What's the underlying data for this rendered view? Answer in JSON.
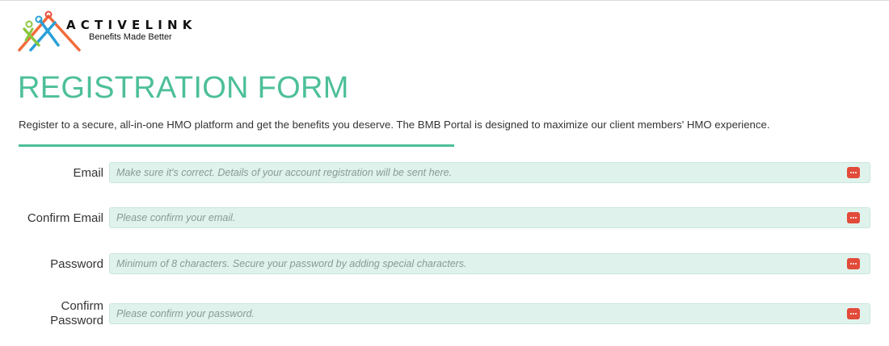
{
  "brand": {
    "name": "ACTIVELINK",
    "tagline": "Benefits Made Better",
    "colors": {
      "orange": "#f26b3a",
      "blue": "#2a9fd8",
      "green": "#8cc63f",
      "red": "#e94e3c"
    }
  },
  "header": {
    "title": "REGISTRATION FORM",
    "intro": "Register to a secure, all-in-one HMO platform and get the benefits you deserve. The BMB Portal is designed to maximize our client members' HMO experience."
  },
  "theme": {
    "accent": "#4dbf9a",
    "field_bg": "#dff3ec",
    "icon_red": "#e24b3a"
  },
  "form": {
    "fields": [
      {
        "label": "Email",
        "placeholder": "Make sure it's correct. Details of your account registration will be sent here.",
        "value": "",
        "icon": "password-manager-icon"
      },
      {
        "label": "Confirm Email",
        "placeholder": "Please confirm your email.",
        "value": "",
        "icon": "password-manager-icon"
      },
      {
        "label": "Password",
        "placeholder": "Minimum of 8 characters. Secure your password by adding special characters.",
        "value": "",
        "icon": "password-manager-icon"
      },
      {
        "label": "Confirm Password",
        "label_line1": "Confirm",
        "label_line2": "Password",
        "placeholder": "Please confirm your password.",
        "value": "",
        "icon": "password-manager-icon"
      }
    ]
  }
}
